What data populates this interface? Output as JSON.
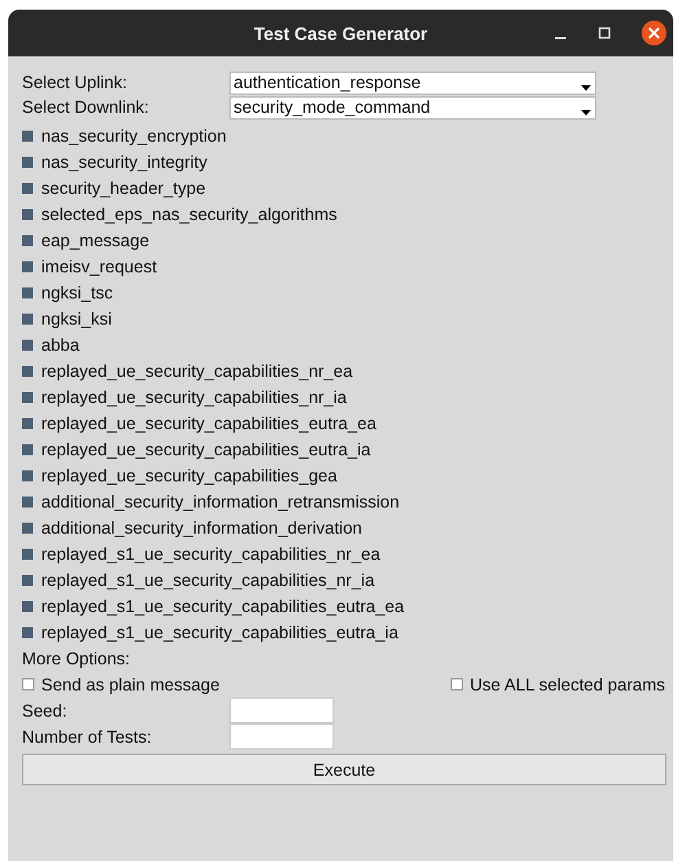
{
  "window": {
    "title": "Test Case Generator"
  },
  "uplink": {
    "label": "Select Uplink:",
    "value": "authentication_response"
  },
  "downlink": {
    "label": "Select Downlink:",
    "value": "security_mode_command"
  },
  "params": [
    {
      "label": "nas_security_encryption",
      "checked": true
    },
    {
      "label": "nas_security_integrity",
      "checked": true
    },
    {
      "label": "security_header_type",
      "checked": true
    },
    {
      "label": "selected_eps_nas_security_algorithms",
      "checked": true
    },
    {
      "label": "eap_message",
      "checked": true
    },
    {
      "label": "imeisv_request",
      "checked": true
    },
    {
      "label": "ngksi_tsc",
      "checked": true
    },
    {
      "label": "ngksi_ksi",
      "checked": true
    },
    {
      "label": "abba",
      "checked": true
    },
    {
      "label": "replayed_ue_security_capabilities_nr_ea",
      "checked": true
    },
    {
      "label": "replayed_ue_security_capabilities_nr_ia",
      "checked": true
    },
    {
      "label": "replayed_ue_security_capabilities_eutra_ea",
      "checked": true
    },
    {
      "label": "replayed_ue_security_capabilities_eutra_ia",
      "checked": true
    },
    {
      "label": "replayed_ue_security_capabilities_gea",
      "checked": true
    },
    {
      "label": "additional_security_information_retransmission",
      "checked": true
    },
    {
      "label": "additional_security_information_derivation",
      "checked": true
    },
    {
      "label": "replayed_s1_ue_security_capabilities_nr_ea",
      "checked": true
    },
    {
      "label": "replayed_s1_ue_security_capabilities_nr_ia",
      "checked": true
    },
    {
      "label": "replayed_s1_ue_security_capabilities_eutra_ea",
      "checked": true
    },
    {
      "label": "replayed_s1_ue_security_capabilities_eutra_ia",
      "checked": true
    }
  ],
  "more_options": {
    "label": "More Options:"
  },
  "send_plain": {
    "label": "Send as plain message",
    "checked": false
  },
  "use_all": {
    "label": "Use ALL selected params",
    "checked": false
  },
  "seed": {
    "label": "Seed:"
  },
  "num_tests": {
    "label": "Number of Tests:"
  },
  "execute_button": "Execute"
}
